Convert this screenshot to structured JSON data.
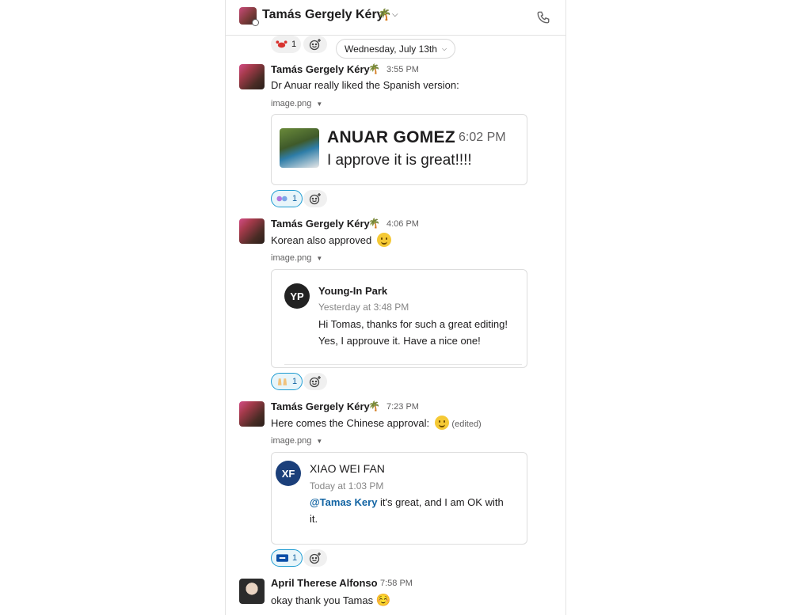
{
  "header": {
    "title": "Tamás Gergely Kéry",
    "emoji": "🌴",
    "phone_icon": "phone-icon"
  },
  "top_reaction": {
    "count": "1"
  },
  "date_divider": {
    "label": "Wednesday, July 13th"
  },
  "messages": [
    {
      "sender": "Tamás Gergely Kéry",
      "status_emoji": "🌴",
      "time": "3:55 PM",
      "text": "Dr Anuar really liked the Spanish version:",
      "file": "image.png",
      "preview": {
        "name": "ANUAR GOMEZ",
        "time": "6:02 PM",
        "text": "I approve it is great!!!!"
      },
      "reaction_count": "1"
    },
    {
      "sender": "Tamás Gergely Kéry",
      "status_emoji": "🌴",
      "time": "4:06 PM",
      "text": "Korean also approved",
      "file": "image.png",
      "preview": {
        "initials": "YP",
        "name": "Young-In Park",
        "subtitle": "Yesterday at 3:48 PM",
        "line1": "Hi Tomas, thanks for such a great editing!",
        "line2": "Yes, I approuve it. Have a nice one!"
      },
      "reaction_count": "1"
    },
    {
      "sender": "Tamás Gergely Kéry",
      "status_emoji": "🌴",
      "time": "7:23 PM",
      "text": "Here comes the Chinese approval:",
      "edited": "(edited)",
      "file": "image.png",
      "preview": {
        "initials": "XF",
        "name": "XIAO WEI FAN",
        "subtitle": "Today at 1:03 PM",
        "mention": "@Tamas Kery",
        "line1_rest": " it's great, and I am OK with",
        "line2": "it."
      },
      "reaction_count": "1"
    },
    {
      "sender": "April Therese Alfonso",
      "time": "7:58 PM",
      "text": "okay thank you Tamas",
      "emoji": "☺️"
    }
  ]
}
